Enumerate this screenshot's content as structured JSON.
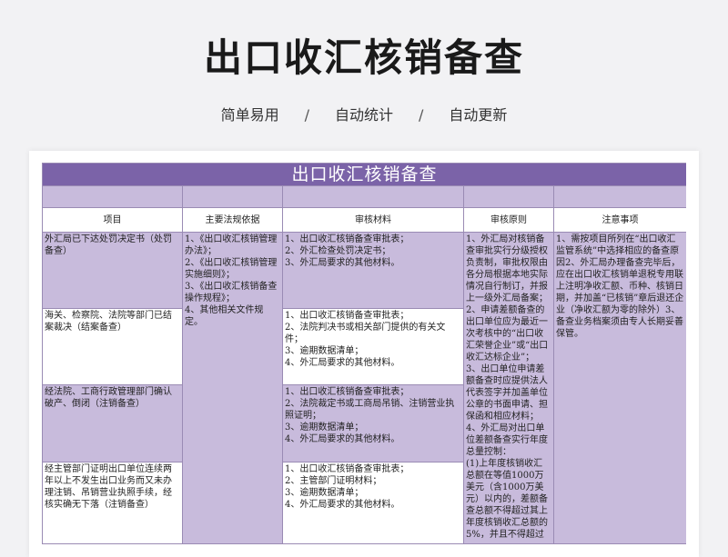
{
  "page": {
    "title": "出口收汇核销备查",
    "subtitle": [
      "简单易用",
      "/",
      "自动统计",
      "/",
      "自动更新"
    ]
  },
  "sheet": {
    "title": "出口收汇核销备查",
    "columns": [
      "项目",
      "主要法规依据",
      "审核材料",
      "审核原则",
      "注意事项"
    ],
    "rows": [
      {
        "item": "外汇局已下达处罚决定书（处罚备查）",
        "materials": "1、出口收汇核销备查审批表；\n2、外汇检查处罚决定书；\n3、外汇局要求的其他材料。"
      },
      {
        "item": "海关、检察院、法院等部门已结案裁决（结案备查）",
        "materials": "1、出口收汇核销备查审批表；\n2、法院判决书或相关部门提供的有关文件；\n3、逾期数据清单；\n4、外汇局要求的其他材料。"
      },
      {
        "item": "经法院、工商行政管理部门确认破产、倒闭（注销备查）",
        "materials": "1、出口收汇核销备查审批表；\n2、法院裁定书或工商局吊销、注销营业执照证明；\n3、逾期数据清单；\n4、外汇局要求的其他材料。"
      },
      {
        "item": "经主管部门证明出口单位连续两年以上不发生出口业务而又未办理注销、吊销营业执照手续，经核实确无下落（注销备查）",
        "materials": "1、出口收汇核销备查审批表；\n2、主管部门证明材料；\n3、逾期数据清单；\n4、外汇局要求的其他材料。"
      }
    ],
    "regulations": "1、《出口收汇核销管理办法》；\n2、《出口收汇核销管理实施细则》；\n3、《出口收汇核销备查操作规程》；\n4、其他相关文件规定。",
    "principles": "1、外汇局对核销备查审批实行分级授权负责制，审批权限由各分局根据本地实际情况自行制订，并报上一级外汇局备案；\n2、申请差额备查的出口单位应为最近一次考核中的“出口收汇荣誉企业”或“出口收汇达标企业”；\n3、出口单位申请差额备查时应提供法人代表签字并加盖单位公章的书面申请、担保函和相应材料；\n4、外汇局对出口单位差额备查实行年度总量控制：\n(1)上年度核销收汇总额在等值1000万美元（含1000万美元）以内的，差额备查总额不得超过其上年度核销收汇总额的5%，并且不得超过",
    "notes": "1、需按项目所列在“出口收汇监管系统”中选择相应的备查原因2、外汇局办理备查完毕后，应在出口收汇核销单退税专用联上注明净收汇额、币种、核销日期，并加盖“已核销”章后退还企业（净收汇额为零的除外）3、备查业务档案须由专人长期妥善保管。"
  },
  "colors": {
    "header_purple": "#7b63a8",
    "light_purple": "#c8bbdc",
    "border": "#9a8bb4"
  }
}
